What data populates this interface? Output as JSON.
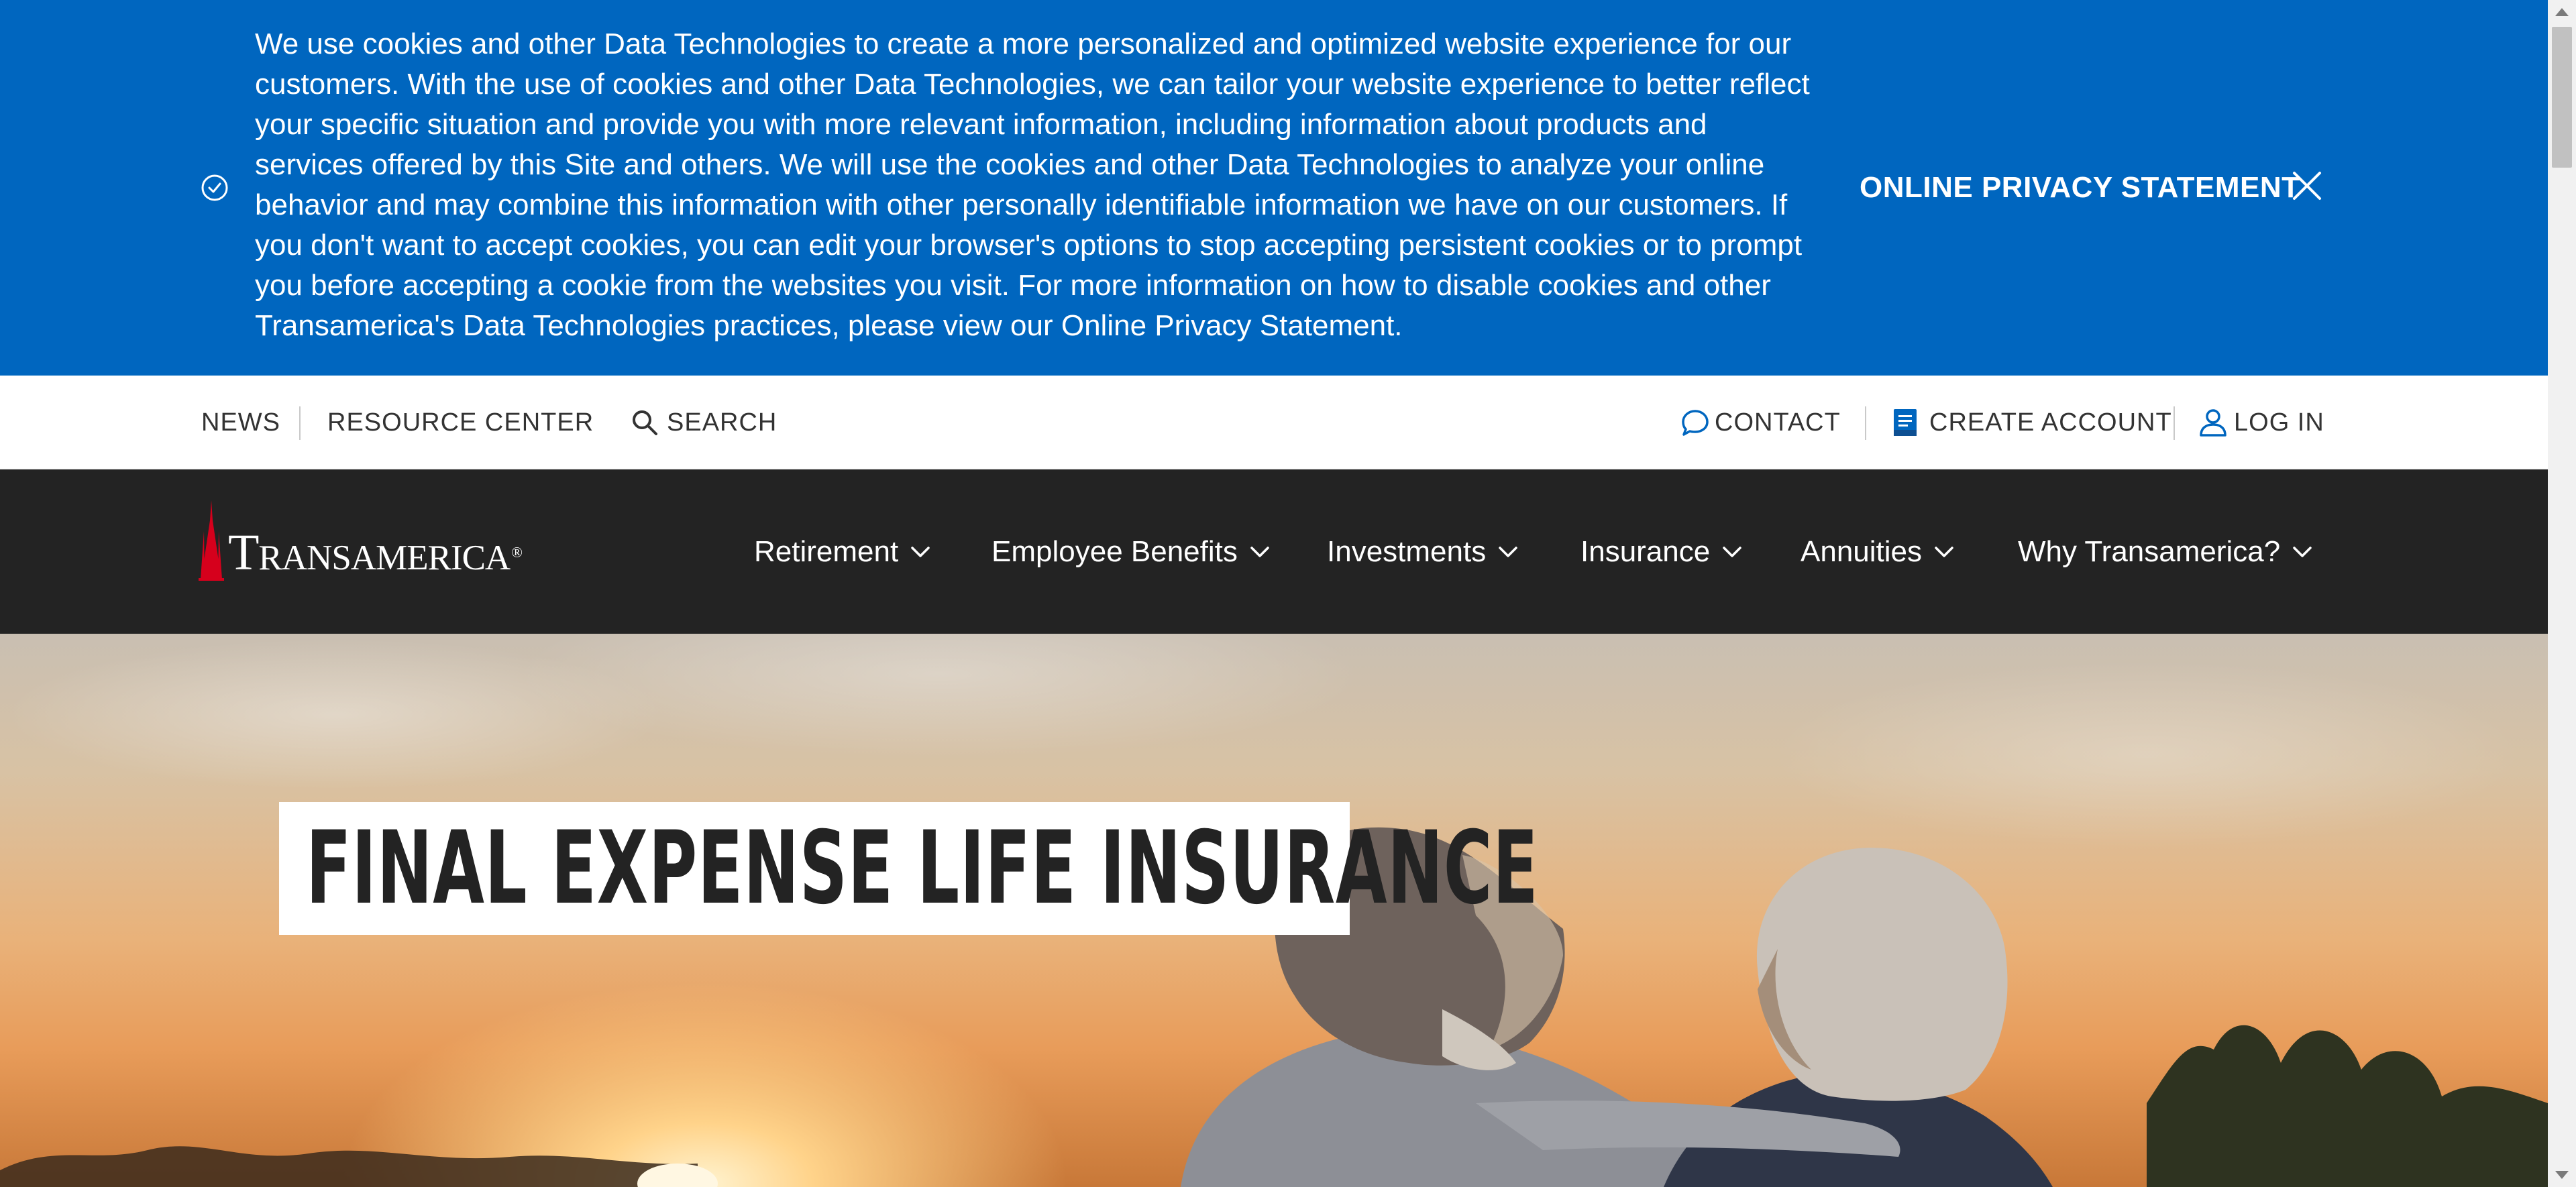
{
  "cookie_banner": {
    "text": "We use cookies and other Data Technologies to create a more personalized and optimized website experience for our customers. With the use of cookies and other Data Technologies, we can tailor your website experience to better reflect your specific situation and provide you with more relevant information, including information about products and services offered by this Site and others. We will use the cookies and other Data Technologies to analyze your online behavior and may combine this information with other personally identifiable information we have on our customers. If you don't want to accept cookies, you can edit your browser's options to stop accepting persistent cookies or to prompt you before accepting a cookie from the websites you visit. For more information on how to disable cookies and other Transamerica's Data Technologies practices, please view our Online Privacy Statement.",
    "privacy_link": "ONLINE PRIVACY STATEMENT",
    "close_icon": "close-icon",
    "check_icon": "check-circle-icon",
    "background_color": "#0066bf"
  },
  "utility_bar": {
    "news": "NEWS",
    "resource_center": "RESOURCE CENTER",
    "search": "SEARCH",
    "contact": "CONTACT",
    "create_account": "CREATE ACCOUNT",
    "log_in": "LOG IN",
    "icon_color": "#0066bf"
  },
  "main_nav": {
    "logo_text": "Transamerica",
    "logo_mark": "®",
    "items": [
      {
        "label": "Retirement"
      },
      {
        "label": "Employee Benefits"
      },
      {
        "label": "Investments"
      },
      {
        "label": "Insurance"
      },
      {
        "label": "Annuities"
      },
      {
        "label": "Why Transamerica?"
      }
    ],
    "background_color": "#232323",
    "brand_red": "#d6001c"
  },
  "hero": {
    "title": "FINAL EXPENSE LIFE INSURANCE"
  }
}
